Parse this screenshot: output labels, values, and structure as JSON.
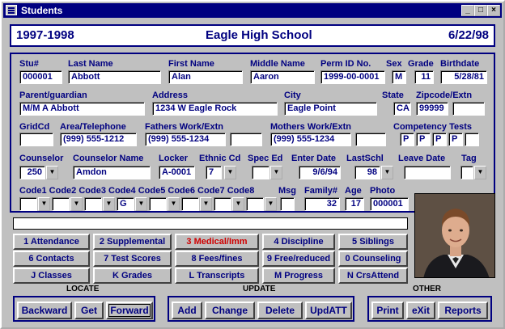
{
  "window": {
    "title": "Students"
  },
  "header": {
    "year": "1997-1998",
    "school": "Eagle High School",
    "date": "6/22/98"
  },
  "labels": {
    "stu_num": "Stu#",
    "last_name": "Last Name",
    "first_name": "First Name",
    "middle_name": "Middle Name",
    "perm_id": "Perm ID No.",
    "sex": "Sex",
    "grade": "Grade",
    "birthdate": "Birthdate",
    "parent": "Parent/guardian",
    "address": "Address",
    "city": "City",
    "state": "State",
    "zip": "Zipcode/Extn",
    "gridcd": "GridCd",
    "area_tel": "Area/Telephone",
    "father_work": "Fathers Work/Extn",
    "mother_work": "Mothers Work/Extn",
    "competency": "Competency Tests",
    "counselor": "Counselor",
    "counselor_name": "Counselor Name",
    "locker": "Locker",
    "ethnic": "Ethnic Cd",
    "spec_ed": "Spec Ed",
    "enter_date": "Enter Date",
    "lastschl": "LastSchl",
    "leave_date": "Leave Date",
    "tag": "Tag",
    "codes": "Code1 Code2 Code3 Code4 Code5 Code6 Code7 Code8",
    "msg": "Msg",
    "family": "Family#",
    "age": "Age",
    "photo": "Photo"
  },
  "values": {
    "stu_num": "000001",
    "last_name": "Abbott",
    "first_name": "Alan",
    "middle_name": "Aaron",
    "perm_id": "1999-00-0001",
    "sex": "M",
    "grade": "11",
    "birthdate": "5/28/81",
    "parent": "M/M A Abbott",
    "address": "1234 W Eagle Rock",
    "city": "Eagle Point",
    "state": "CA",
    "zip": "99999",
    "zip_ext": "",
    "gridcd": "",
    "area_tel": "(999) 555-1212",
    "father_work": "(999) 555-1234",
    "father_ext": "",
    "mother_work": "(999) 555-1234",
    "mother_ext": "",
    "comp1": "P",
    "comp2": "P",
    "comp3": "P",
    "comp4": "P",
    "counselor": "250",
    "counselor_name": "Amdon",
    "locker": "A-0001",
    "ethnic": "7",
    "spec_ed": "",
    "enter_date": "9/6/94",
    "lastschl": "98",
    "leave_date": "",
    "tag": "",
    "code4": "G",
    "msg": "",
    "family": "32",
    "age": "17",
    "photo": "000001"
  },
  "tabs": {
    "attendance": "1 Attendance",
    "supplemental": "2 Supplemental",
    "medical": "3 Medical/Imm",
    "discipline": "4 Discipline",
    "siblings": "5 Siblings",
    "contacts": "6 Contacts",
    "test_scores": "7 Test Scores",
    "fees": "8 Fees/fines",
    "free_reduced": "9 Free/reduced",
    "counseling": "0 Counseling",
    "classes": "J Classes",
    "grades": "K Grades",
    "transcripts": "L Transcripts",
    "progress": "M Progress",
    "crsattend": "N CrsAttend"
  },
  "groups": {
    "locate": "LOCATE",
    "update": "UPDATE",
    "other": "OTHER"
  },
  "commands": {
    "backward": "Backward",
    "get": "Get",
    "forward": "Forward",
    "add": "Add",
    "change": "Change",
    "delete": "Delete",
    "updatt": "UpdATT",
    "print": "Print",
    "exit": "eXit",
    "reports": "Reports"
  },
  "colors": {
    "accent": "#000080",
    "alert": "#d00000",
    "face": "#c0c0c0"
  }
}
